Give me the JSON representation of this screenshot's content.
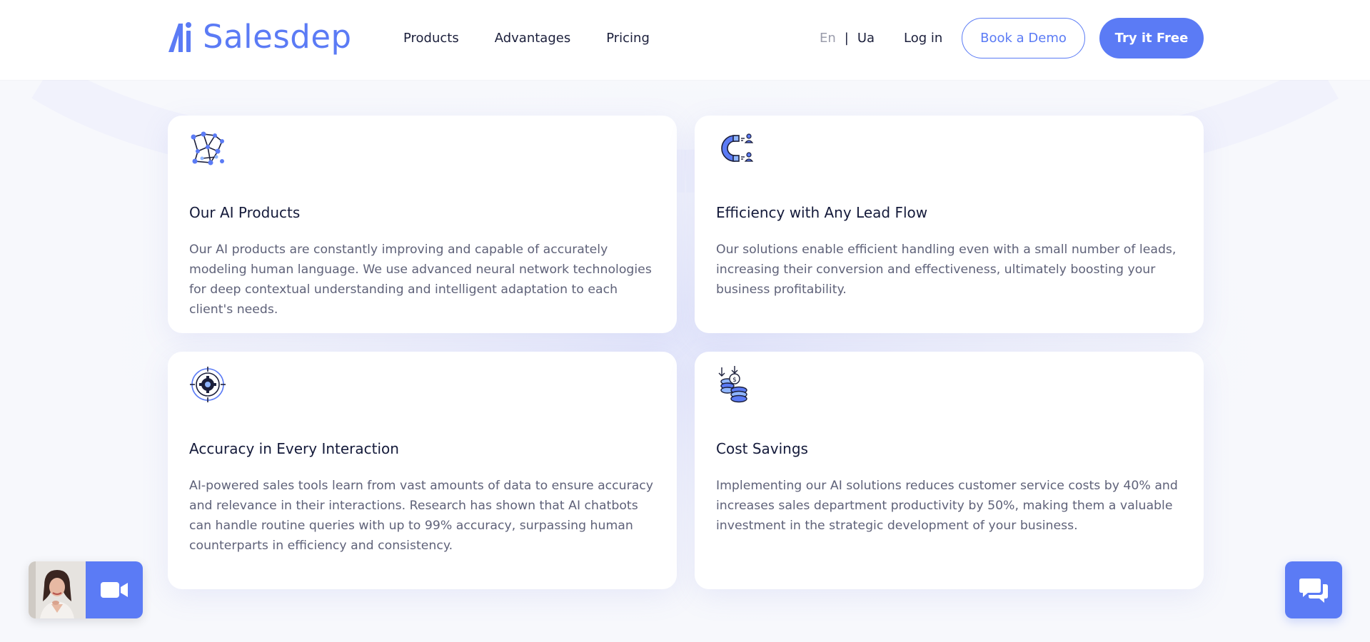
{
  "brand": {
    "name": "Salesdep"
  },
  "nav": {
    "items": [
      {
        "label": "Products"
      },
      {
        "label": "Advantages"
      },
      {
        "label": "Pricing"
      }
    ]
  },
  "lang": {
    "en": "En",
    "separator": "|",
    "ua": "Ua"
  },
  "auth": {
    "login": "Log in"
  },
  "cta": {
    "demo": "Book a Demo",
    "free": "Try it Free"
  },
  "colors": {
    "accent": "#5b7bf5",
    "heading": "#141a3a",
    "body": "#5f6279"
  },
  "cards": [
    {
      "icon": "neural-network-icon",
      "title": "Our AI Products",
      "text": "Our AI products are constantly improving and capable of accurately modeling human language. We use advanced neural network technologies for deep contextual understanding and intelligent adaptation to each client's needs."
    },
    {
      "icon": "magnet-leads-icon",
      "title": "Efficiency with Any Lead Flow",
      "text": "Our solutions enable efficient handling even with a small number of leads, increasing their conversion and effectiveness, ultimately boosting your business profitability."
    },
    {
      "icon": "target-gear-icon",
      "title": "Accuracy in Every Interaction",
      "text": "AI-powered sales tools learn from vast amounts of data to ensure accuracy and relevance in their interactions. Research has shown that AI chatbots can handle routine queries with up to 99% accuracy, surpassing human counterparts in efficiency and consistency."
    },
    {
      "icon": "coins-stack-icon",
      "title": "Cost Savings",
      "text": "Implementing our AI solutions reduces customer service costs by 40% and increases sales department productivity by 50%, making them a valuable investment in the strategic development of your business."
    }
  ],
  "widgets": {
    "video": "video-camera-icon",
    "chat": "chat-bubbles-icon"
  }
}
